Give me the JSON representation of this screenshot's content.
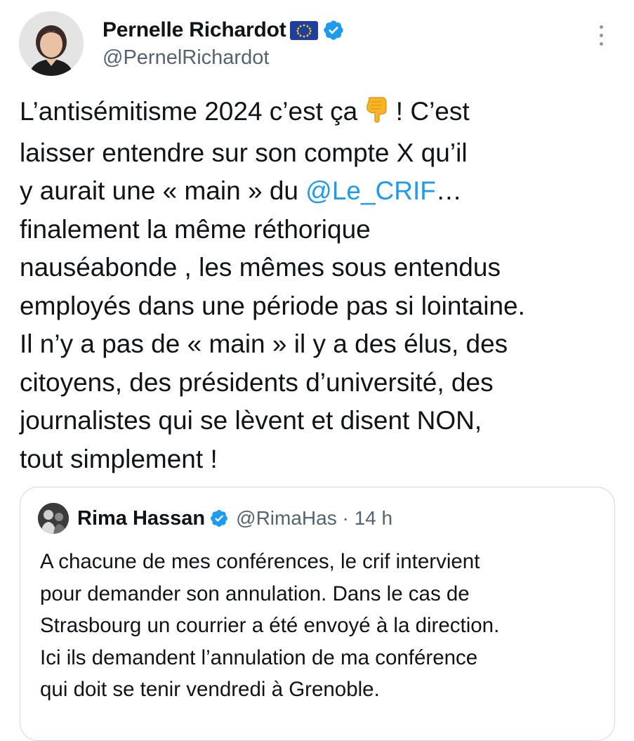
{
  "author": {
    "display_name": "Pernelle Richardot",
    "flag_icon": "eu-flag-icon",
    "verified_icon": "verified-badge-icon",
    "handle": "@PernelRichardot"
  },
  "more_icon": "more-options-icon",
  "tweet": {
    "text_part1": "L’antisémitisme 2024 c’est ça ",
    "emoji_icon": "pointing-down-emoji-icon",
    "text_part2": " ! C’est\nlaisser entendre sur son compte X qu’il\ny aurait une « main » du ",
    "mention": "@Le_CRIF",
    "text_part3": "…\nfinalement la même réthorique\nnauséabonde , les mêmes sous entendus\nemployés dans une période pas si lointaine.\nIl n’y a pas de « main » il y a des élus, des\ncitoyens, des présidents d’université, des\njournalistes qui se lèvent et disent NON,\ntout simplement !"
  },
  "quote": {
    "display_name": "Rima Hassan",
    "verified_icon": "verified-badge-icon",
    "handle_time": "@RimaHas · 14 h",
    "text": "A chacune de mes conférences, le crif intervient\npour demander son annulation. Dans le cas de\nStrasbourg un courrier a été envoyé à la direction.\nIci ils demandent l’annulation de ma conférence\nqui doit se tenir vendredi à Grenoble."
  },
  "colors": {
    "mention": "#1d9bf0",
    "verified": "#1d9bf0",
    "secondary_text": "#536471",
    "border": "#cfd9de"
  }
}
